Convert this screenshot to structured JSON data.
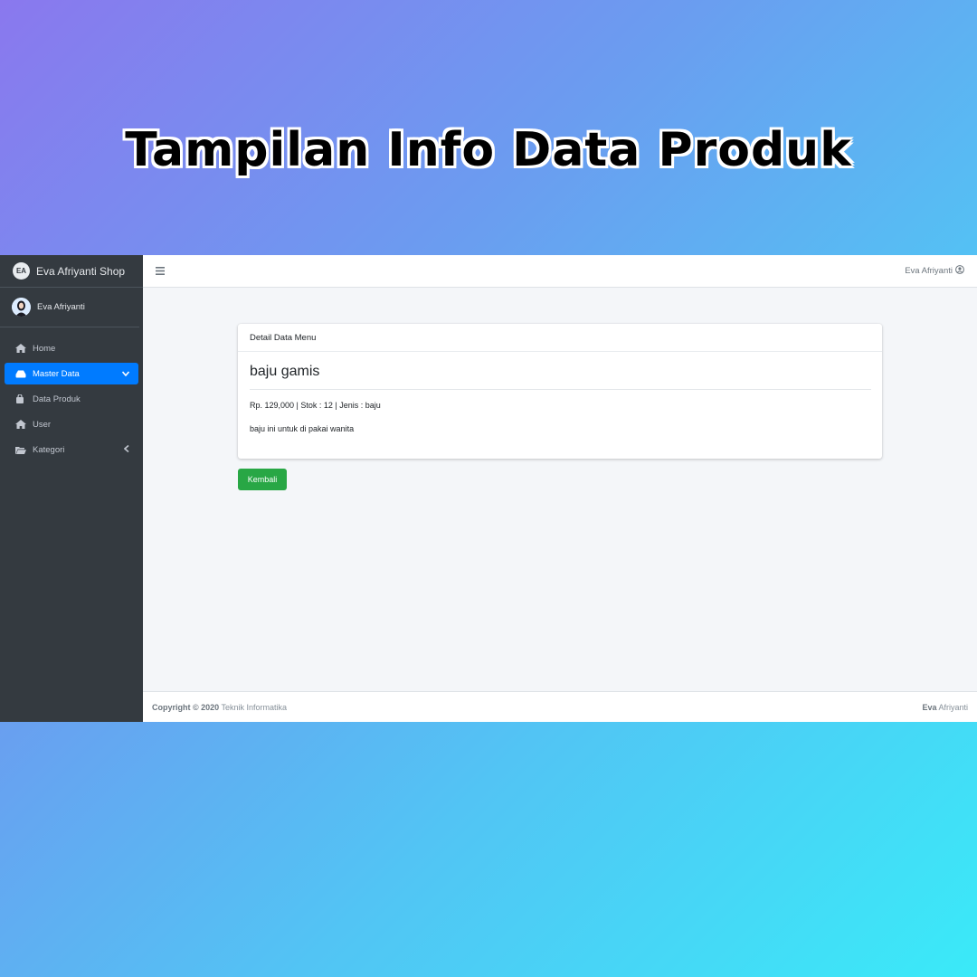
{
  "banner": {
    "title": "Tampilan Info Data Produk"
  },
  "sidebar": {
    "brand": {
      "logo_text": "EA",
      "name": "Eva Afriyanti Shop"
    },
    "user": {
      "name": "Eva Afriyanti"
    },
    "items": [
      {
        "label": "Home",
        "icon": "home-icon",
        "active": false
      },
      {
        "label": "Master Data",
        "icon": "database-icon",
        "active": true
      },
      {
        "label": "Data Produk",
        "icon": "shopping-bag-icon",
        "active": false
      },
      {
        "label": "User",
        "icon": "home-icon",
        "active": false
      },
      {
        "label": "Kategori",
        "icon": "folder-open-icon",
        "active": false
      }
    ]
  },
  "topbar": {
    "user_name": "Eva Afriyanti"
  },
  "card": {
    "header": "Detail Data Menu",
    "product_name": "baju gamis",
    "meta": "Rp. 129,000 | Stok : 12 | Jenis : baju",
    "description": "baju ini untuk di pakai wanita"
  },
  "back_button": {
    "label": "Kembali"
  },
  "footer": {
    "copyright_prefix": "Copyright © 2020",
    "copyright_link": "Teknik Informatika",
    "right_bold": "Eva",
    "right_text": "Afriyanti"
  },
  "colors": {
    "sidebar_bg": "#343a40",
    "active_item": "#007bff",
    "button_green": "#28a745",
    "content_bg": "#f4f6f9"
  }
}
